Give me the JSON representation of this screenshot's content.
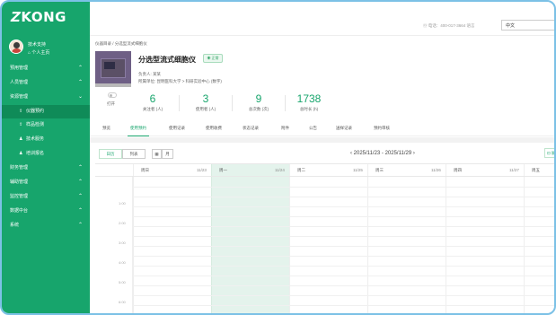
{
  "brand": {
    "logo_mark": "Z",
    "logo_text": "KONG"
  },
  "user": {
    "name": "技术支持",
    "home_link": "个人主页"
  },
  "sidebar": {
    "groups": [
      {
        "label": "预用管理",
        "chevron": "⌃"
      },
      {
        "label": "人员管理",
        "chevron": "⌃"
      },
      {
        "label": "资源管理",
        "chevron": "⌄"
      }
    ],
    "resource_items": [
      {
        "label": "仪器预约",
        "icon": "instrument-icon"
      },
      {
        "label": "样品检测",
        "icon": "sample-icon"
      },
      {
        "label": "技术服务",
        "icon": "service-icon"
      },
      {
        "label": "培训报名",
        "icon": "training-icon"
      }
    ],
    "bottom_groups": [
      {
        "label": "财务管理",
        "chevron": "⌃"
      },
      {
        "label": "辅助管理",
        "chevron": "⌃"
      },
      {
        "label": "监控管理",
        "chevron": "⌃"
      },
      {
        "label": "数据中台",
        "chevron": "⌃"
      },
      {
        "label": "系统",
        "chevron": "⌃"
      }
    ]
  },
  "topbar": {
    "phone_info": "电话：400-017-3664 语言",
    "language": "中文"
  },
  "breadcrumb": "仪器目录  /  分选型流式细胞仪",
  "instrument": {
    "title": "分选型流式细胞仪",
    "status": "正常",
    "manager": "负责人: 某某",
    "unit": "所属单位: 昆明医科大学 > 科研实验中心 (数字)",
    "toggle_label": "打开"
  },
  "stats": [
    {
      "value": "6",
      "label": "关注者 (人)"
    },
    {
      "value": "3",
      "label": "使用者 (人)"
    },
    {
      "value": "9",
      "label": "总次数 (次)"
    },
    {
      "value": "1738",
      "label": "总时长 (h)"
    }
  ],
  "tabs": [
    "预览",
    "使用预约",
    "使用记录",
    "使用收费",
    "状态记录",
    "附件",
    "公告",
    "送样记录",
    "预约审核"
  ],
  "active_tab_index": 1,
  "calendar": {
    "view_day": "日历",
    "view_list": "列表",
    "view_icon": "▦",
    "view_month": "月",
    "prev": "‹",
    "next": "›",
    "range": "2025/11/23 - 2025/11/29",
    "right_button": "⊡ 展",
    "days": [
      {
        "label": "周日",
        "date": "11/23"
      },
      {
        "label": "周一",
        "date": "11/24"
      },
      {
        "label": "周二",
        "date": "11/25"
      },
      {
        "label": "周三",
        "date": "11/26"
      },
      {
        "label": "周四",
        "date": "11/27"
      },
      {
        "label": "周五",
        "date": ""
      }
    ],
    "times": [
      "1:00",
      "2:00",
      "3:00",
      "4:00",
      "5:00",
      "6:00"
    ]
  },
  "colors": {
    "accent": "#17a56c",
    "sidebar": "#17a56c",
    "active_nav": "#0f8b58",
    "today_col": "#e4f3ec"
  }
}
